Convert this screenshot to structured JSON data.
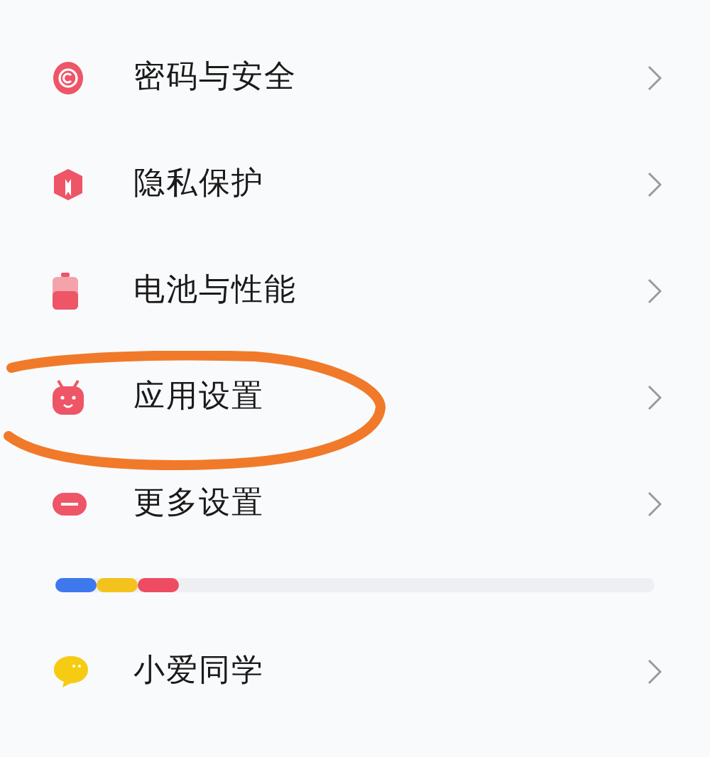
{
  "settings_items": [
    {
      "label": "密码与安全",
      "highlighted": false
    },
    {
      "label": "隐私保护",
      "highlighted": false
    },
    {
      "label": "电池与性能",
      "highlighted": false
    },
    {
      "label": "应用设置",
      "highlighted": true
    },
    {
      "label": "更多设置",
      "highlighted": false
    }
  ],
  "storage_bar": {
    "segments": [
      {
        "color": "#3e78ee"
      },
      {
        "color": "#f4c21c"
      },
      {
        "color": "#ee4c63"
      }
    ]
  },
  "assistant_items": [
    {
      "label": "小爱同学",
      "highlighted": false
    }
  ]
}
